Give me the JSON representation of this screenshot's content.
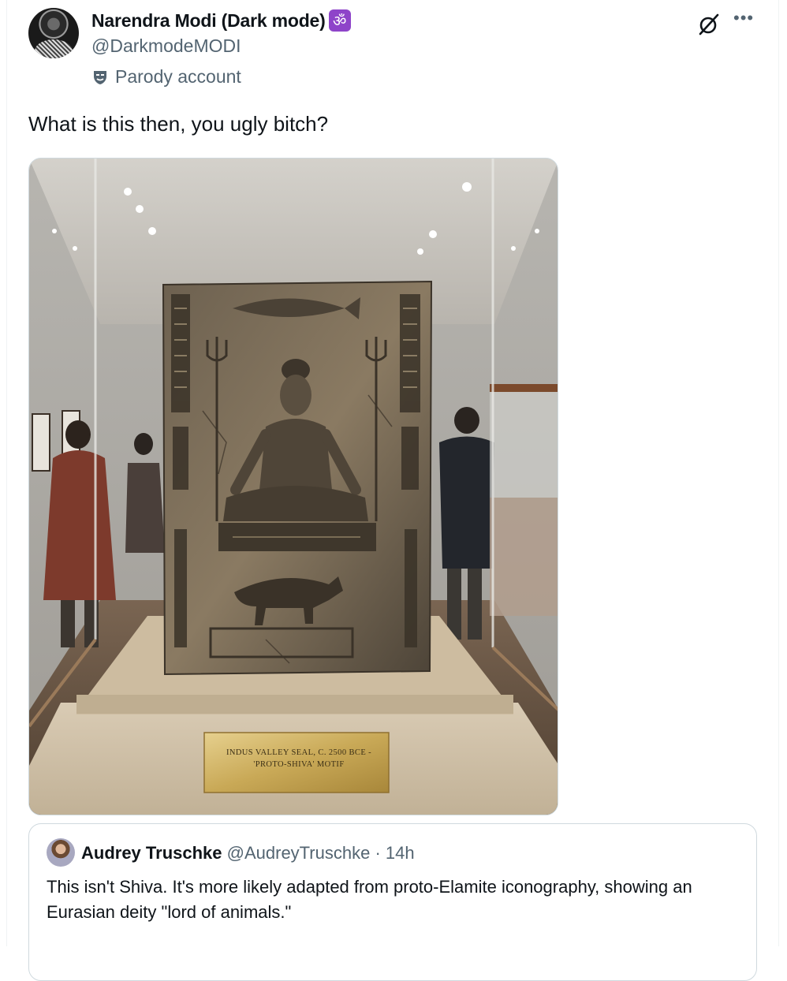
{
  "author": {
    "display_name": "Narendra Modi (Dark mode)",
    "badge_glyph": "ॐ",
    "handle": "@DarkmodeMODI",
    "label": "Parody account"
  },
  "tweet": {
    "text": "What is this then, you ugly bitch?"
  },
  "media": {
    "plaque_line_1": "Indus Valley Seal, c. 2500 bce -",
    "plaque_line_2": "'Proto-Shiva' Motif"
  },
  "quoted_tweet": {
    "name": "Audrey Truschke",
    "handle": "@AudreyTruschke",
    "separator": " · ",
    "time": "14h",
    "text": "This isn't Shiva. It's more likely adapted from proto-Elamite iconography, showing an Eurasian deity \"lord of animals.\""
  },
  "icons": {
    "more": "more-icon",
    "grok": "grok-icon",
    "parody": "parody-mask-icon"
  },
  "colors": {
    "text": "#0f1419",
    "secondary": "#536471",
    "border": "#cfd9de",
    "badge": "#8e44c9"
  }
}
